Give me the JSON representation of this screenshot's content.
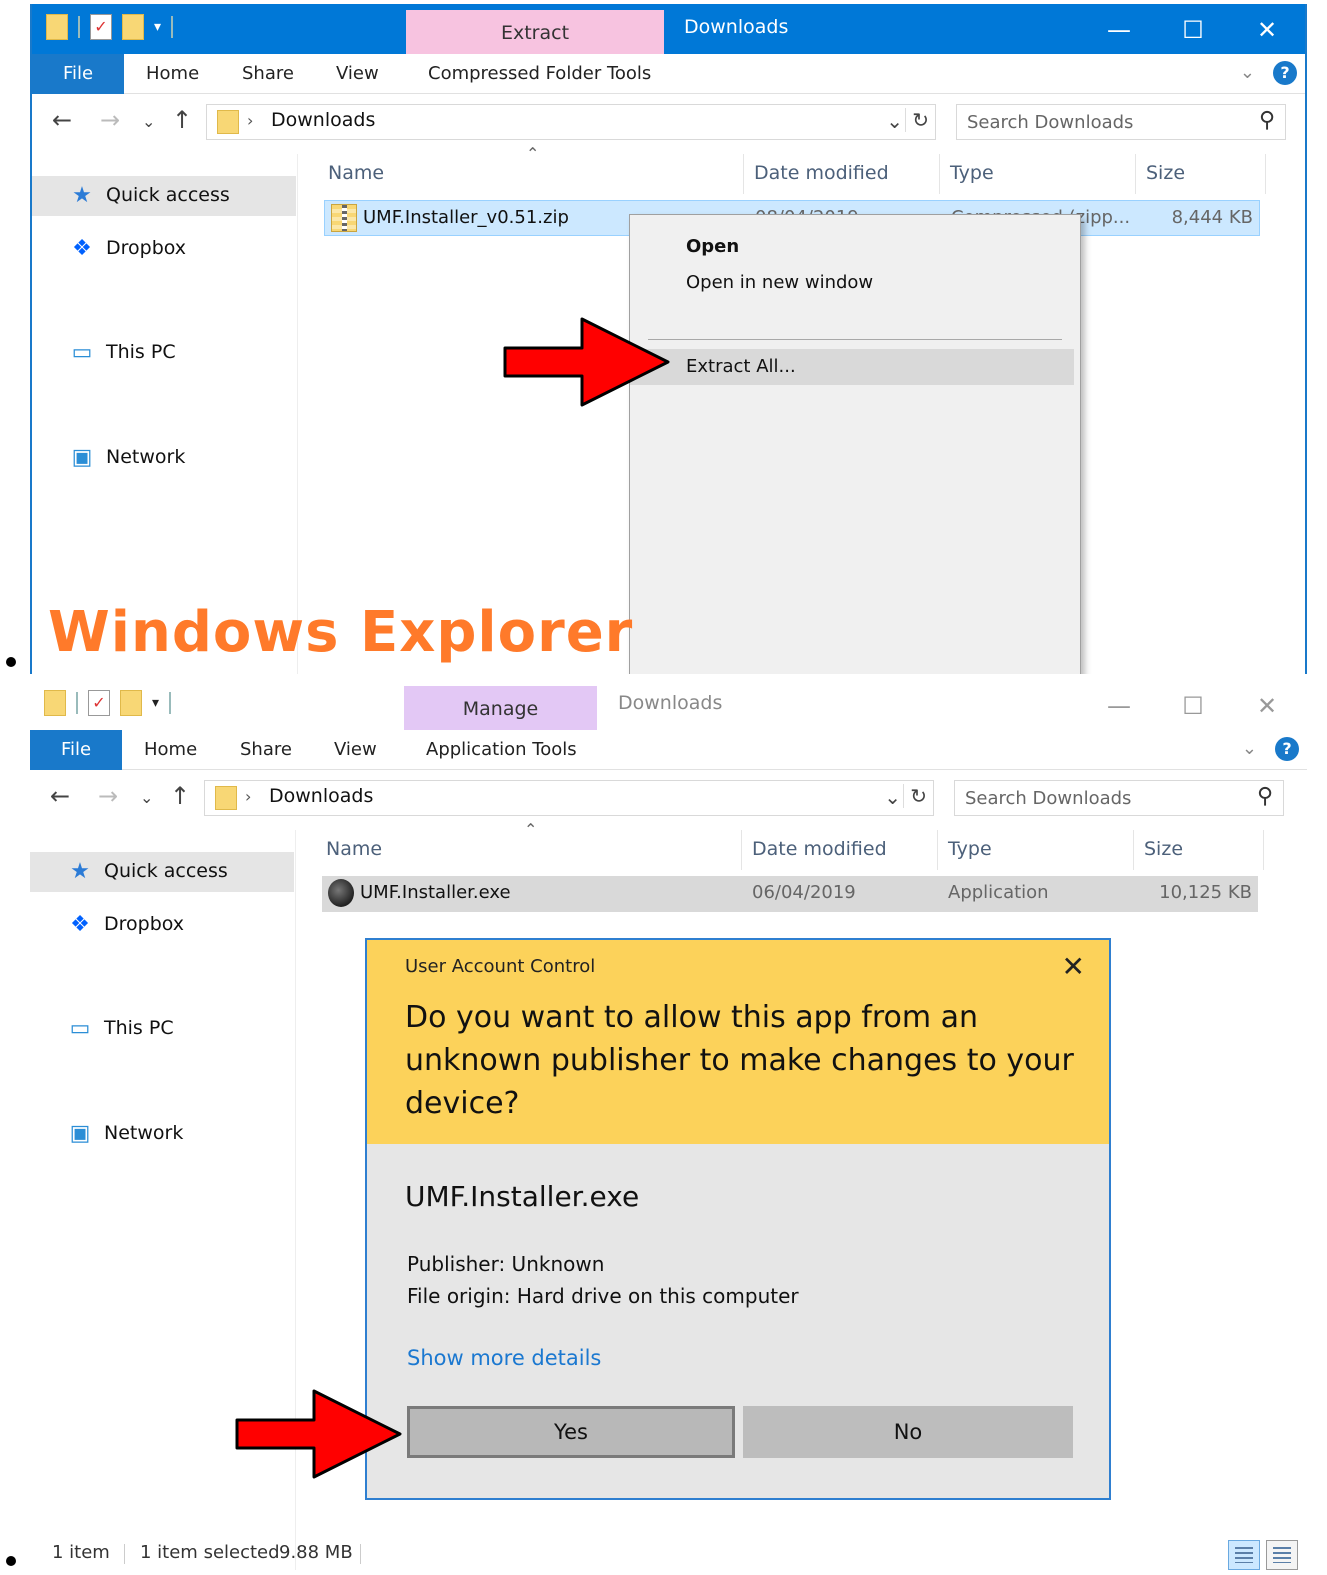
{
  "panel1": {
    "title": "Downloads",
    "context_tab_header": "Extract",
    "ribbon": {
      "file": "File",
      "home": "Home",
      "share": "Share",
      "view": "View",
      "context": "Compressed Folder Tools"
    },
    "address": {
      "location": "Downloads",
      "search_placeholder": "Search Downloads"
    },
    "nav": [
      "Quick access",
      "Dropbox",
      "This PC",
      "Network"
    ],
    "columns": {
      "name": "Name",
      "date": "Date modified",
      "type": "Type",
      "size": "Size"
    },
    "file": {
      "name": "UMF.Installer_v0.51.zip",
      "date": "08/04/2019",
      "type": "Compressed (zipp...",
      "size": "8,444 KB"
    },
    "context_menu": {
      "open": "Open",
      "open_new": "Open in new window",
      "extract_all": "Extract All..."
    },
    "overlay_label": "Windows Explorer"
  },
  "panel2": {
    "title": "Downloads",
    "context_tab_header": "Manage",
    "ribbon": {
      "file": "File",
      "home": "Home",
      "share": "Share",
      "view": "View",
      "context": "Application Tools"
    },
    "address": {
      "location": "Downloads",
      "search_placeholder": "Search Downloads"
    },
    "nav": [
      "Quick access",
      "Dropbox",
      "This PC",
      "Network"
    ],
    "columns": {
      "name": "Name",
      "date": "Date modified",
      "type": "Type",
      "size": "Size"
    },
    "file": {
      "name": "UMF.Installer.exe",
      "date": "06/04/2019",
      "type": "Application",
      "size": "10,125 KB"
    },
    "uac": {
      "header": "User Account Control",
      "question": "Do you want to allow this app from an unknown publisher to make changes to your device?",
      "app_name": "UMF.Installer.exe",
      "publisher": "Publisher: Unknown",
      "origin": "File origin: Hard drive on this computer",
      "more_details": "Show more details",
      "yes": "Yes",
      "no": "No"
    },
    "status": {
      "count": "1 item",
      "selected": "1 item selected",
      "size": "9.88 MB"
    }
  },
  "colors": {
    "accent": "#0078d7",
    "arrow": "#ff0000",
    "uac_banner": "#fcd25a",
    "overlay_text": "#ff7a2a",
    "link": "#1b78d0"
  },
  "icons": {
    "min": "—",
    "max": "☐",
    "close": "✕",
    "back": "←",
    "forward": "→",
    "recent": "⌄",
    "up": "↑",
    "dropdown": "⌄",
    "refresh": "↻",
    "search": "⚲",
    "sort": "⌃",
    "crumb": "›",
    "help": "?",
    "chevron": "⌄"
  }
}
